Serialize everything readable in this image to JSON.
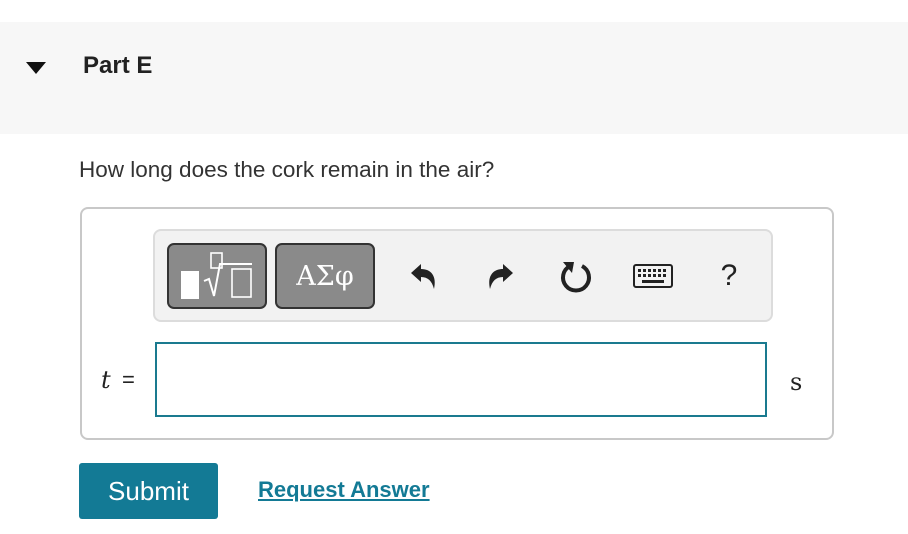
{
  "part": {
    "title": "Part E",
    "caret_icon": "caret-down-icon"
  },
  "question": {
    "text": "How long does the cork remain in the air?"
  },
  "toolbar": {
    "templates_icon": "templates-root-icon",
    "symbols_label": "ΑΣφ",
    "undo_icon": "undo-icon",
    "redo_icon": "redo-icon",
    "reset_icon": "reset-icon",
    "keyboard_icon": "keyboard-icon",
    "help_label": "?"
  },
  "answer": {
    "variable": "t",
    "equals": "=",
    "value": "",
    "unit": "s"
  },
  "actions": {
    "submit_label": "Submit",
    "request_label": "Request Answer"
  },
  "colors": {
    "accent": "#137a95",
    "input_border": "#1a7a8f",
    "header_bg": "#f7f7f7",
    "toolbar_bg": "#f2f2f2",
    "template_button_bg": "#8a8a8a"
  }
}
